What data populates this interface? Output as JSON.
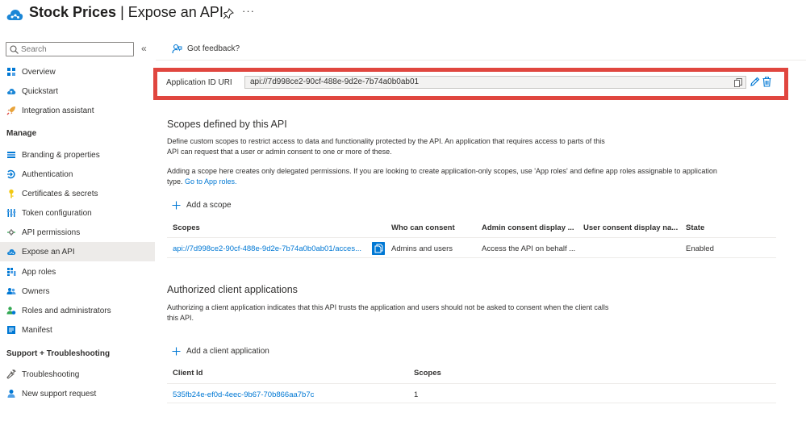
{
  "header": {
    "app_name": "Stock Prices",
    "separator": " | ",
    "page_name": "Expose an API",
    "more": "···"
  },
  "sidebar": {
    "search_placeholder": "Search",
    "collapse": "«",
    "items": [
      {
        "label": "Overview",
        "icon": "overview-grid-icon"
      },
      {
        "label": "Quickstart",
        "icon": "quickstart-cloud-icon"
      },
      {
        "label": "Integration assistant",
        "icon": "rocket-icon"
      }
    ],
    "manage_heading": "Manage",
    "manage_items": [
      {
        "label": "Branding & properties",
        "icon": "branding-icon"
      },
      {
        "label": "Authentication",
        "icon": "authentication-icon"
      },
      {
        "label": "Certificates & secrets",
        "icon": "key-icon"
      },
      {
        "label": "Token configuration",
        "icon": "token-config-icon"
      },
      {
        "label": "API permissions",
        "icon": "api-permissions-icon"
      },
      {
        "label": "Expose an API",
        "icon": "expose-api-cloud-icon",
        "active": true
      },
      {
        "label": "App roles",
        "icon": "app-roles-icon"
      },
      {
        "label": "Owners",
        "icon": "owners-icon"
      },
      {
        "label": "Roles and administrators",
        "icon": "roles-admins-icon"
      },
      {
        "label": "Manifest",
        "icon": "manifest-icon"
      }
    ],
    "support_heading": "Support + Troubleshooting",
    "support_items": [
      {
        "label": "Troubleshooting",
        "icon": "wrench-icon"
      },
      {
        "label": "New support request",
        "icon": "support-person-icon"
      }
    ]
  },
  "toolbar": {
    "feedback_label": "Got feedback?"
  },
  "app_id_uri": {
    "label": "Application ID URI",
    "value": "api://7d998ce2-90cf-488e-9d2e-7b74a0b0ab01"
  },
  "scopes_section": {
    "title": "Scopes defined by this API",
    "description_line1": "Define custom scopes to restrict access to data and functionality protected by the API. An application that requires access to parts of this",
    "description_line2": "API can request that a user or admin consent to one or more of these.",
    "note_line1": "Adding a scope here creates only delegated permissions. If you are looking to create application-only scopes, use 'App roles' and define app roles assignable to application",
    "note_line2_prefix": "type. ",
    "note_link": "Go to App roles.",
    "add_label": "Add a scope",
    "columns": [
      "Scopes",
      "Who can consent",
      "Admin consent display ...",
      "User consent display na...",
      "State"
    ],
    "rows": [
      {
        "scope": "api://7d998ce2-90cf-488e-9d2e-7b74a0b0ab01/acces...",
        "who": "Admins and users",
        "admin_display": "Access the API on behalf ...",
        "user_display": "",
        "state": "Enabled"
      }
    ]
  },
  "clients_section": {
    "title": "Authorized client applications",
    "description_line1": "Authorizing a client application indicates that this API trusts the application and users should not be asked to consent when the client calls",
    "description_line2": "this API.",
    "add_label": "Add a client application",
    "columns": [
      "Client Id",
      "Scopes"
    ],
    "rows": [
      {
        "client_id": "535fb24e-ef0d-4eec-9b67-70b866aa7b7c",
        "scopes": "1"
      }
    ]
  },
  "colors": {
    "accent": "#0078d4",
    "highlight_border": "#e0463f",
    "active_nav_bg": "#edebe9"
  }
}
